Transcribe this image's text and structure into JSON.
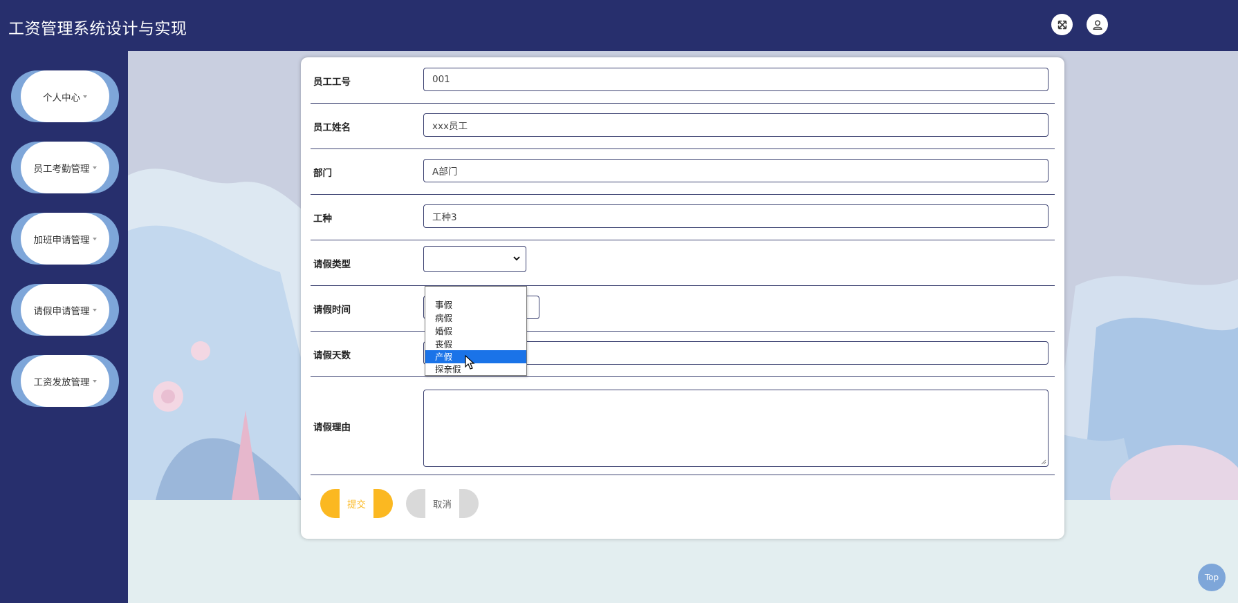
{
  "header": {
    "title": "工资管理系统设计与实现",
    "fullscreen_icon": "expand-icon",
    "user_icon": "user-icon"
  },
  "sidebar": {
    "items": [
      {
        "label": "个人中心"
      },
      {
        "label": "员工考勤管理"
      },
      {
        "label": "加班申请管理"
      },
      {
        "label": "请假申请管理"
      },
      {
        "label": "工资发放管理"
      }
    ]
  },
  "form": {
    "employee_id": {
      "label": "员工工号",
      "value": "001"
    },
    "employee_name": {
      "label": "员工姓名",
      "value": "xxx员工"
    },
    "department": {
      "label": "部门",
      "value": "A部门"
    },
    "job_type": {
      "label": "工种",
      "value": "工种3"
    },
    "leave_type": {
      "label": "请假类型",
      "value": ""
    },
    "leave_time": {
      "label": "请假时间",
      "value": ""
    },
    "leave_days": {
      "label": "请假天数",
      "value": ""
    },
    "leave_reason": {
      "label": "请假理由",
      "value": ""
    },
    "submit_label": "提交",
    "cancel_label": "取消"
  },
  "leave_type_options": [
    "",
    "事假",
    "病假",
    "婚假",
    "丧假",
    "产假",
    "探亲假"
  ],
  "leave_type_highlighted": "产假",
  "top_button": "Top",
  "colors": {
    "header_bg": "#272f6d",
    "pill_accent": "#7ea6d9",
    "submit": "#fbb821",
    "cancel": "#d9d9d9",
    "highlight": "#1a73e8"
  }
}
